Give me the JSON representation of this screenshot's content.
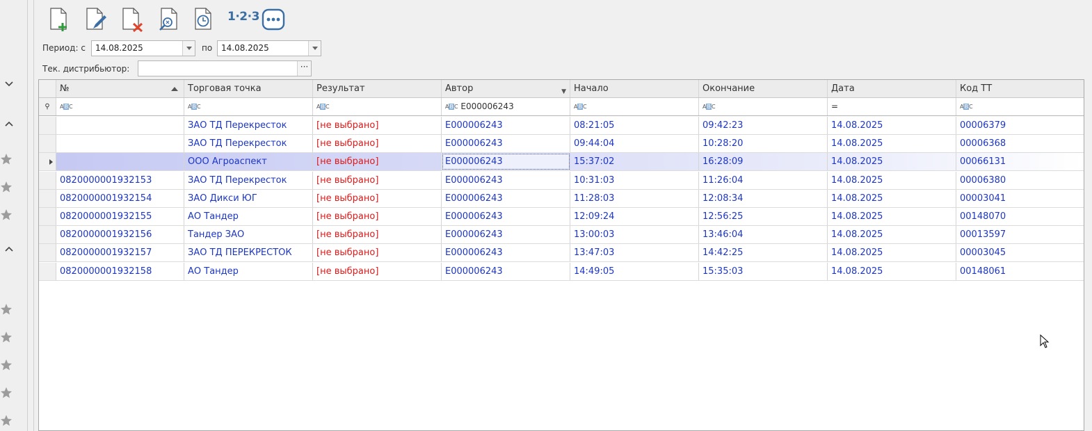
{
  "toolbar": {
    "items": [
      "new-document-icon",
      "edit-document-icon",
      "delete-document-icon",
      "find-document-icon",
      "history-document-icon",
      "numbering",
      "more-icon"
    ],
    "numbering_label": "1·2·3"
  },
  "period": {
    "label": "Период: с",
    "from": "14.08.2025",
    "to_label": "по",
    "to": "14.08.2025"
  },
  "distributor": {
    "label": "Тек. дистрибьютор:",
    "value": "",
    "ellipsis": "···"
  },
  "grid": {
    "columns": [
      "№",
      "Торговая точка",
      "Результат",
      "Автор",
      "Начало",
      "Окончание",
      "Дата",
      "Код ТТ"
    ],
    "filter_author": "E000006243",
    "filter_date": "=",
    "rows": [
      {
        "no": "",
        "point": "ЗАО ТД Перекресток",
        "result": "[не выбрано]",
        "author": "E000006243",
        "start": "08:21:05",
        "end": "09:42:23",
        "date": "14.08.2025",
        "code": "00006379"
      },
      {
        "no": "",
        "point": "ЗАО ТД Перекресток",
        "result": "[не выбрано]",
        "author": "E000006243",
        "start": "09:44:04",
        "end": "10:28:20",
        "date": "14.08.2025",
        "code": "00006368"
      },
      {
        "no": "",
        "point": "ООО Агроаспект",
        "result": "[не выбрано]",
        "author": "E000006243",
        "start": "15:37:02",
        "end": "16:28:09",
        "date": "14.08.2025",
        "code": "00066131"
      },
      {
        "no": "0820000001932153",
        "point": "ЗАО ТД Перекресток",
        "result": "[не выбрано]",
        "author": "E000006243",
        "start": "10:31:03",
        "end": "11:26:04",
        "date": "14.08.2025",
        "code": "00006380"
      },
      {
        "no": "0820000001932154",
        "point": "ЗАО Дикси ЮГ",
        "result": "[не выбрано]",
        "author": "E000006243",
        "start": "11:28:03",
        "end": "12:08:34",
        "date": "14.08.2025",
        "code": "00003041"
      },
      {
        "no": "0820000001932155",
        "point": "АО Тандер",
        "result": "[не выбрано]",
        "author": "E000006243",
        "start": "12:09:24",
        "end": "12:56:25",
        "date": "14.08.2025",
        "code": "00148070"
      },
      {
        "no": "0820000001932156",
        "point": "Тандер ЗАО",
        "result": "[не выбрано]",
        "author": "E000006243",
        "start": "13:00:03",
        "end": "13:46:04",
        "date": "14.08.2025",
        "code": "00013597"
      },
      {
        "no": "0820000001932157",
        "point": "ЗАО ТД ПЕРЕКРЕСТОК",
        "result": "[не выбрано]",
        "author": "E000006243",
        "start": "13:47:03",
        "end": "14:42:25",
        "date": "14.08.2025",
        "code": "00003045"
      },
      {
        "no": "0820000001932158",
        "point": "АО Тандер",
        "result": "[не выбрано]",
        "author": "E000006243",
        "start": "14:49:05",
        "end": "15:35:03",
        "date": "14.08.2025",
        "code": "00148061"
      }
    ],
    "selected_row": 2
  },
  "colors": {
    "link_text": "#1c36c7",
    "result_text": "#e01818",
    "selection": "#c5c9f3",
    "toolbar_icon": "#3a6ea5"
  }
}
